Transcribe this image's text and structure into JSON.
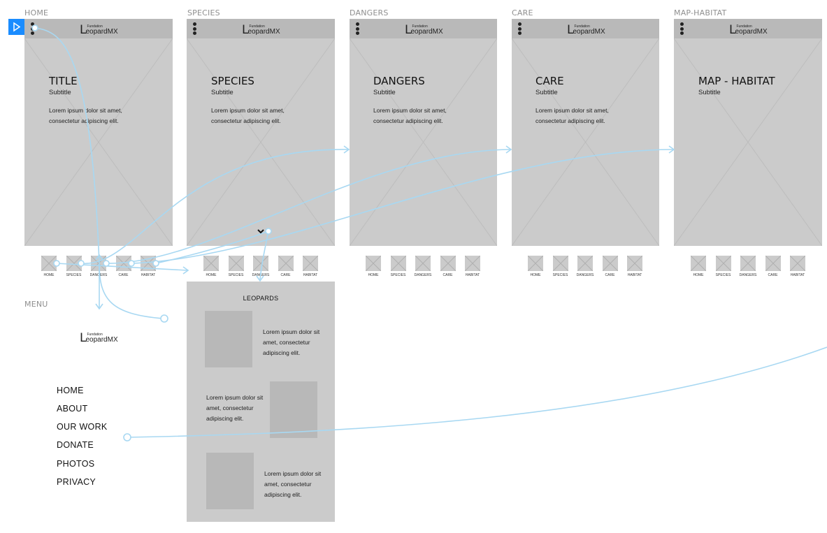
{
  "frames": [
    {
      "label": "HOME",
      "title": "TITLE",
      "subtitle": "Subtitle",
      "body": "Lorem ipsum dolor sit amet, consectetur adipiscing elit."
    },
    {
      "label": "SPECIES",
      "title": "SPECIES",
      "subtitle": "Subtitle",
      "body": "Lorem ipsum dolor sit amet, consectetur adipiscing elit."
    },
    {
      "label": "DANGERS",
      "title": "DANGERS",
      "subtitle": "Subtitle",
      "body": "Lorem ipsum dolor sit amet, consectetur adipiscing elit."
    },
    {
      "label": "CARE",
      "title": "CARE",
      "subtitle": "Subtitle",
      "body": "Lorem ipsum dolor sit amet, consectetur adipiscing elit."
    },
    {
      "label": "MAP-HABITAT",
      "title": "MAP - HABITAT",
      "subtitle": "Subtitle",
      "body": ""
    }
  ],
  "logo": {
    "prefix": "L",
    "small": "Fundation",
    "word": "eopardMX"
  },
  "nav": [
    "HOME",
    "SPECIES",
    "DANGERS",
    "CARE",
    "HABITAT"
  ],
  "menu": {
    "label": "MENU",
    "items": [
      "HOME",
      "ABOUT",
      "OUR WORK",
      "DONATE",
      "PHOTOS",
      "PRIVACY"
    ]
  },
  "leopards": {
    "title": "LEOPARDS",
    "items": [
      "Lorem ipsum dolor sit amet, consectetur adipiscing elit.",
      "Lorem ipsum dolor sit amet, consectetur adipiscing elit.",
      "Lorem ipsum dolor sit amet, consectetur adipiscing elit."
    ]
  },
  "icons": {
    "play": "play-icon",
    "menu": "kebab-menu-icon",
    "expand": "chevron-down-icon"
  },
  "colors": {
    "flow": "#a8d8f2",
    "play": "#1a8cff",
    "wireframe": "#cbcbcb",
    "topbar": "#b9b9b9"
  }
}
